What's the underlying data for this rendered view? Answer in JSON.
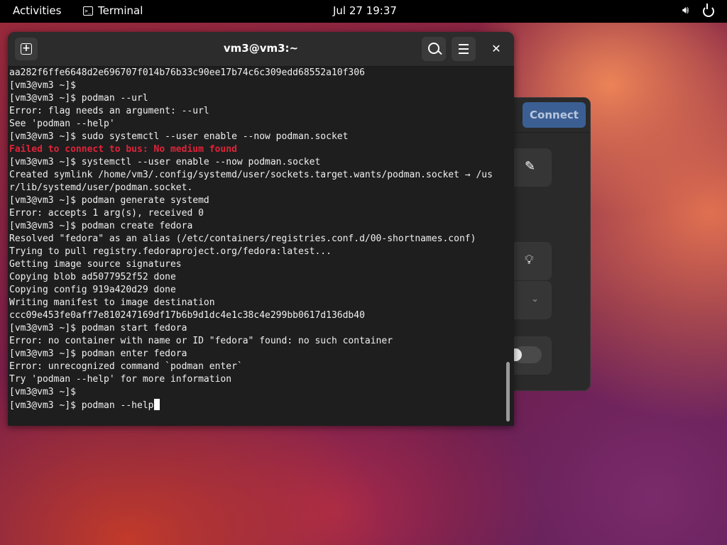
{
  "topbar": {
    "activities": "Activities",
    "app_name": "Terminal",
    "clock": "Jul 27  19:37"
  },
  "background_window": {
    "connect_label": "Connect"
  },
  "terminal": {
    "title": "vm3@vm3:~",
    "lines": [
      {
        "text": "aa282f6ffe6648d2e696707f014b76b33c90ee17b74c6c309edd68552a10f306",
        "type": "output"
      },
      {
        "text": "[vm3@vm3 ~]$",
        "type": "prompt"
      },
      {
        "text": "[vm3@vm3 ~]$ podman --url",
        "type": "prompt"
      },
      {
        "text": "Error: flag needs an argument: --url",
        "type": "output"
      },
      {
        "text": "See 'podman --help'",
        "type": "output"
      },
      {
        "text": "[vm3@vm3 ~]$ sudo systemctl --user enable --now podman.socket",
        "type": "prompt"
      },
      {
        "text": "Failed to connect to bus: No medium found",
        "type": "error"
      },
      {
        "text": "[vm3@vm3 ~]$ systemctl --user enable --now podman.socket",
        "type": "prompt"
      },
      {
        "text": "Created symlink /home/vm3/.config/systemd/user/sockets.target.wants/podman.socket → /us",
        "type": "output"
      },
      {
        "text": "r/lib/systemd/user/podman.socket.",
        "type": "output"
      },
      {
        "text": "[vm3@vm3 ~]$ podman generate systemd",
        "type": "prompt"
      },
      {
        "text": "Error: accepts 1 arg(s), received 0",
        "type": "output"
      },
      {
        "text": "[vm3@vm3 ~]$ podman create fedora",
        "type": "prompt"
      },
      {
        "text": "Resolved \"fedora\" as an alias (/etc/containers/registries.conf.d/00-shortnames.conf)",
        "type": "output"
      },
      {
        "text": "Trying to pull registry.fedoraproject.org/fedora:latest...",
        "type": "output"
      },
      {
        "text": "Getting image source signatures",
        "type": "output"
      },
      {
        "text": "Copying blob ad5077952f52 done",
        "type": "output"
      },
      {
        "text": "Copying config 919a420d29 done",
        "type": "output"
      },
      {
        "text": "Writing manifest to image destination",
        "type": "output"
      },
      {
        "text": "ccc09e453fe0aff7e810247169df17b6b9d1dc4e1c38c4e299bb0617d136db40",
        "type": "output"
      },
      {
        "text": "[vm3@vm3 ~]$ podman start fedora",
        "type": "prompt"
      },
      {
        "text": "Error: no container with name or ID \"fedora\" found: no such container",
        "type": "output"
      },
      {
        "text": "[vm3@vm3 ~]$ podman enter fedora",
        "type": "prompt"
      },
      {
        "text": "Error: unrecognized command `podman enter`",
        "type": "output"
      },
      {
        "text": "Try 'podman --help' for more information",
        "type": "output"
      },
      {
        "text": "[vm3@vm3 ~]$",
        "type": "prompt"
      }
    ],
    "current_input": "[vm3@vm3 ~]$ podman --help"
  },
  "colors": {
    "error_text": "#e0233a",
    "connect_button": "#3b5f93",
    "terminal_bg": "#1e1e1e",
    "header_bg": "#2c2c2c"
  },
  "icons": {
    "terminal_app": "terminal-icon",
    "volume": "volume-icon",
    "power": "power-icon",
    "new_tab": "new-tab-icon",
    "search": "search-icon",
    "menu": "hamburger-menu-icon",
    "close": "close-icon",
    "edit": "pencil-icon",
    "hint": "lightbulb-icon",
    "expand": "chevron-down-icon"
  }
}
